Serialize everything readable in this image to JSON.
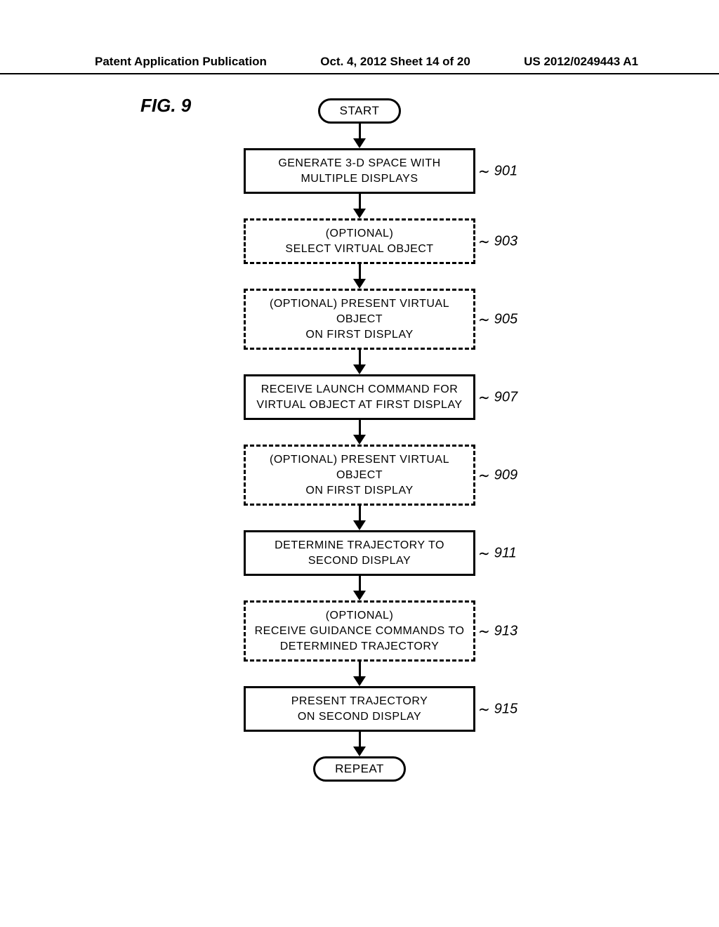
{
  "header": {
    "left": "Patent Application Publication",
    "center": "Oct. 4, 2012   Sheet 14 of 20",
    "right": "US 2012/0249443 A1"
  },
  "figure_label": "FIG. 9",
  "terminals": {
    "start": "START",
    "end": "REPEAT"
  },
  "steps": [
    {
      "id": "901",
      "optional": false,
      "lines": [
        "GENERATE 3-D SPACE WITH",
        "MULTIPLE DISPLAYS"
      ],
      "ref": "901"
    },
    {
      "id": "903",
      "optional": true,
      "lines": [
        "(OPTIONAL)",
        "SELECT VIRTUAL OBJECT"
      ],
      "ref": "903"
    },
    {
      "id": "905",
      "optional": true,
      "lines": [
        "(OPTIONAL) PRESENT VIRTUAL OBJECT",
        "ON FIRST DISPLAY"
      ],
      "ref": "905"
    },
    {
      "id": "907",
      "optional": false,
      "lines": [
        "RECEIVE LAUNCH COMMAND FOR",
        "VIRTUAL OBJECT AT FIRST DISPLAY"
      ],
      "ref": "907"
    },
    {
      "id": "909",
      "optional": true,
      "lines": [
        "(OPTIONAL) PRESENT VIRTUAL OBJECT",
        "ON FIRST DISPLAY"
      ],
      "ref": "909"
    },
    {
      "id": "911",
      "optional": false,
      "lines": [
        "DETERMINE TRAJECTORY TO",
        "SECOND DISPLAY"
      ],
      "ref": "911"
    },
    {
      "id": "913",
      "optional": true,
      "lines": [
        "(OPTIONAL)",
        "RECEIVE GUIDANCE COMMANDS TO",
        "DETERMINED TRAJECTORY"
      ],
      "ref": "913"
    },
    {
      "id": "915",
      "optional": false,
      "lines": [
        "PRESENT TRAJECTORY",
        "ON SECOND DISPLAY"
      ],
      "ref": "915"
    }
  ]
}
